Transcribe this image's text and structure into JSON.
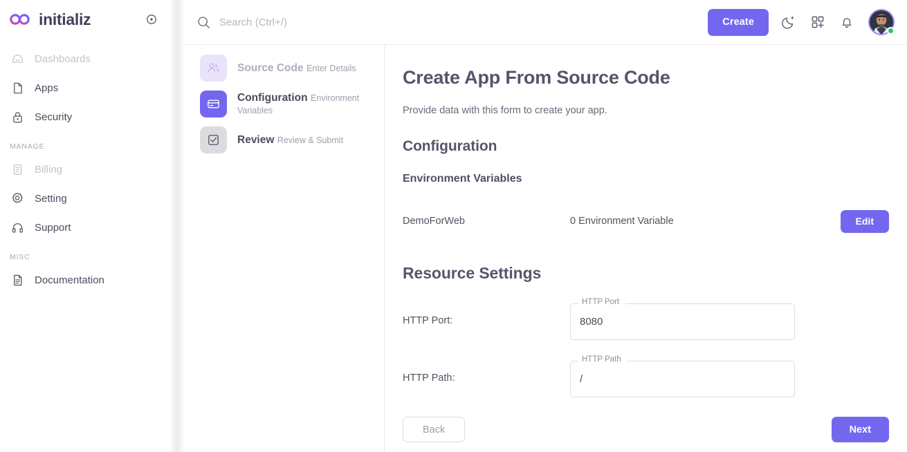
{
  "brand": {
    "name": "initializ",
    "logo_icon": "infinity-logo-icon",
    "pin_icon": "pin-circle-icon"
  },
  "colors": {
    "accent": "#7367F0",
    "accent_soft": "#e9e4fb",
    "step_todo": "#dcdce0",
    "text_dark": "#55566b",
    "text_muted": "#9e9eac",
    "status_online": "#28C76F"
  },
  "sidebar": {
    "items": [
      {
        "label": "Dashboards",
        "icon": "home-icon",
        "muted": true
      },
      {
        "label": "Apps",
        "icon": "file-icon",
        "muted": false
      },
      {
        "label": "Security",
        "icon": "lock-icon",
        "muted": false
      }
    ],
    "group_manage_label": "MANAGE",
    "manage_items": [
      {
        "label": "Billing",
        "icon": "billing-document-icon",
        "muted": true
      },
      {
        "label": "Setting",
        "icon": "gear-icon",
        "muted": false
      },
      {
        "label": "Support",
        "icon": "headset-icon",
        "muted": false
      }
    ],
    "group_misc_label": "MISC",
    "misc_items": [
      {
        "label": "Documentation",
        "icon": "document-icon",
        "muted": false
      }
    ]
  },
  "topbar": {
    "search_placeholder": "Search (Ctrl+/)",
    "search_value": "",
    "search_icon": "search-icon",
    "create_label": "Create",
    "icons": [
      {
        "name": "moon-stars-icon"
      },
      {
        "name": "grid-plus-icon"
      },
      {
        "name": "bell-icon"
      }
    ],
    "avatar_name": "user-avatar",
    "status": "online"
  },
  "stepper": {
    "steps": [
      {
        "title": "Source Code",
        "subtitle": "Enter Details",
        "icon": "users-icon",
        "state": "pending"
      },
      {
        "title": "Configuration",
        "subtitle": "Environment Variables",
        "icon": "credit-card-icon",
        "state": "active"
      },
      {
        "title": "Review",
        "subtitle": "Review & Submit",
        "icon": "checkbox-checked-icon",
        "state": "todo"
      }
    ]
  },
  "main": {
    "page_title": "Create App From Source Code",
    "page_subtitle": "Provide data with this form to create your app.",
    "section_title": "Configuration",
    "subsection_title": "Environment Variables",
    "env_row": {
      "name": "DemoForWeb",
      "count_label": "0 Environment Variable",
      "edit_label": "Edit"
    },
    "resource_title": "Resource Settings",
    "fields": [
      {
        "label": "HTTP Port:",
        "float_label": "HTTP Port",
        "value": "8080",
        "name": "http-port"
      },
      {
        "label": "HTTP Path:",
        "float_label": "HTTP Path",
        "value": "/",
        "name": "http-path"
      }
    ],
    "back_label": "Back",
    "next_label": "Next"
  }
}
